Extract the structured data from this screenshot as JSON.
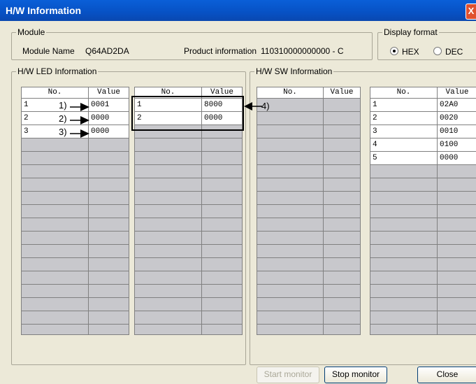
{
  "window": {
    "title": "H/W Information",
    "close_glyph": "X"
  },
  "module": {
    "group_title": "Module",
    "name_label": "Module Name",
    "name_value": "Q64AD2DA",
    "product_label": "Product information",
    "product_value": "110310000000000 - C"
  },
  "display_format": {
    "group_title": "Display format",
    "options": [
      "HEX",
      "DEC"
    ],
    "selected": "HEX"
  },
  "led": {
    "group_title": "H/W LED Information",
    "col_no": "No.",
    "col_value": "Value",
    "table1": [
      {
        "no": "1",
        "value": "0001"
      },
      {
        "no": "2",
        "value": "0000"
      },
      {
        "no": "3",
        "value": "0000"
      }
    ],
    "table2": [
      {
        "no": "1",
        "value": "8000"
      },
      {
        "no": "2",
        "value": "0000"
      }
    ]
  },
  "sw": {
    "group_title": "H/W SW Information",
    "col_no": "No.",
    "col_value": "Value",
    "table3": [],
    "table4": [
      {
        "no": "1",
        "value": "02A0"
      },
      {
        "no": "2",
        "value": "0020"
      },
      {
        "no": "3",
        "value": "0010"
      },
      {
        "no": "4",
        "value": "0100"
      },
      {
        "no": "5",
        "value": "0000"
      }
    ]
  },
  "annotations": [
    "1)",
    "2)",
    "3)",
    "4)"
  ],
  "buttons": {
    "start_monitor": "Start monitor",
    "stop_monitor": "Stop monitor",
    "close": "Close"
  }
}
